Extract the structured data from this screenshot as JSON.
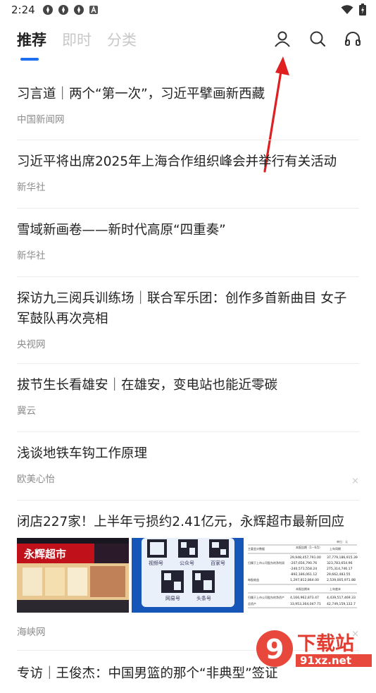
{
  "status_bar": {
    "time": "2:24",
    "left_icons": [
      "notification-icon",
      "notification-icon",
      "notification-icon",
      "notification-icon"
    ],
    "right_icons": [
      "wifi-icon",
      "battery-icon"
    ]
  },
  "tabs": [
    {
      "label": "推荐",
      "active": true
    },
    {
      "label": "即时",
      "active": false
    },
    {
      "label": "分类",
      "active": false
    }
  ],
  "top_icons": [
    "user-icon",
    "search-icon",
    "headphones-icon"
  ],
  "accent_color": "#1e6ff0",
  "annotation_color": "#e02020",
  "feed": [
    {
      "title": "习言道｜两个“第一次”，习近平擘画新西藏",
      "source": "中国新闻网"
    },
    {
      "title": "习近平将出席2025年上海合作组织峰会并举行有关活动",
      "source": "新华社"
    },
    {
      "title": "雪域新画卷——新时代高原“四重奏”",
      "source": "新华社"
    },
    {
      "title": "探访九三阅兵训练场｜联合军乐团：创作多首新曲目 女子军鼓队再次亮相",
      "source": "央视网"
    },
    {
      "title": "拔节生长看雄安｜在雄安，变电站也能近零碳",
      "source": "冀云"
    },
    {
      "title": "浅谈地铁车钩工作原理",
      "source": "欧美心怡",
      "close": "×"
    },
    {
      "title": "闭店227家！上半年亏损约2.41亿元，永辉超市最新回应",
      "source": "海峡网",
      "close": "×",
      "images": {
        "store_sign": "永辉超市",
        "qr_labels": [
          "视频号",
          "公众号",
          "百家号",
          "网易号",
          "头条号"
        ],
        "table": {
          "unit": "单位：元",
          "headers": [
            "主要会计数据",
            "本报告期（1－6月）",
            "上年同期"
          ],
          "rows": [
            [
              "",
              "29,948,457,791.00",
              "37,779,186,915.39"
            ],
            [
              "归属于上市公司股东的净利润",
              "-207,656,790.76",
              "323,783,654.96"
            ],
            [
              "",
              "-240,571,558.24",
              "275,314,746.17"
            ],
            [
              "",
              "-892,186,061.12",
              "29,662,483.55"
            ],
            [
              "每股收益",
              "1,297,812,864.00",
              "2,539,005,971.88"
            ]
          ],
          "headers2": [
            "",
            "本报告期末",
            "上年度末"
          ],
          "rows2": [
            [
              "归属于上市公司股东的净资产",
              "4,166,962,873.47",
              "4,439,517,469.33"
            ],
            [
              "总资产",
              "33,953,364,047.71",
              "42,749,159,132.7"
            ]
          ]
        }
      }
    },
    {
      "title": "专访｜王俊杰：中国男篮的那个“非典型”签证",
      "source": ""
    }
  ],
  "watermark": {
    "logo": "9",
    "brand": "下载站",
    "site": "91xz.net"
  }
}
